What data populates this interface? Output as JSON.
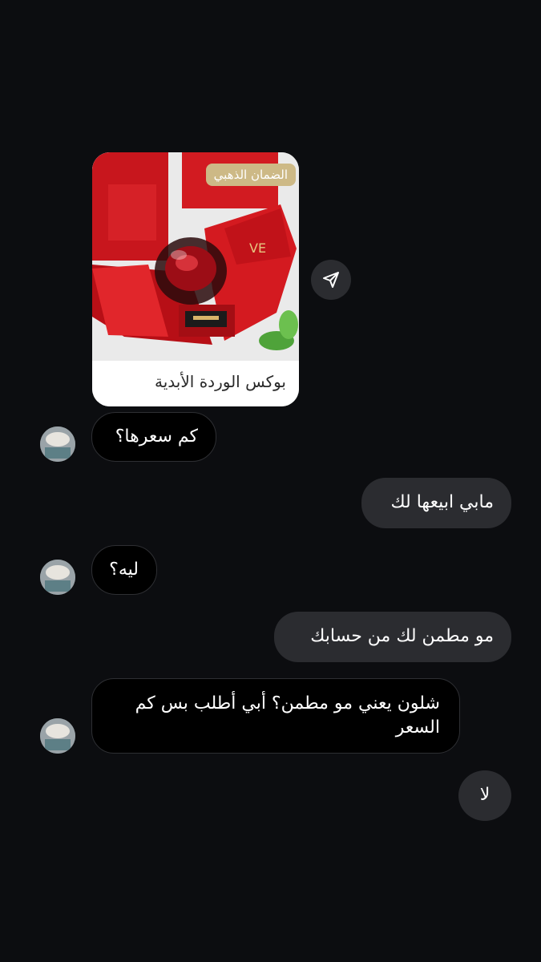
{
  "shared_post": {
    "badge": "الضمان الذهبي",
    "caption": "بوكس الوردة الأبدية",
    "image_text": "VE"
  },
  "messages": [
    {
      "sender": "them",
      "text": "كم سعرها؟"
    },
    {
      "sender": "me",
      "text": "مابي ابيعها لك"
    },
    {
      "sender": "them",
      "text": "ليه؟"
    },
    {
      "sender": "me",
      "text": "مو مطمن لك من حسابك"
    },
    {
      "sender": "them",
      "text": "شلون يعني مو مطمن؟ أبي أطلب بس كم السعر"
    },
    {
      "sender": "me",
      "text": "لا"
    }
  ],
  "icons": {
    "share": "paper-plane-icon",
    "avatar": "contact-avatar"
  },
  "colors": {
    "background": "#0c0d10",
    "outgoing_bubble": "#2b2c30",
    "incoming_bubble": "#000000",
    "badge": "#cdb986"
  }
}
